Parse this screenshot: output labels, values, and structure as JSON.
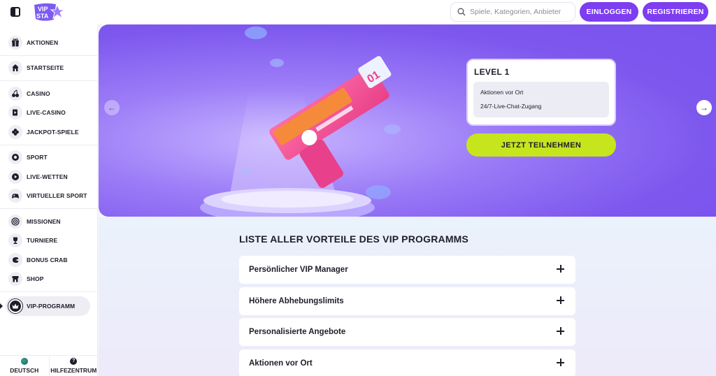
{
  "header": {
    "logo_text": "VIP STAR",
    "search_placeholder": "Spiele, Kategorien, Anbieter",
    "login_label": "EINLOGGEN",
    "register_label": "REGISTRIEREN",
    "accent_color": "#7d3df0"
  },
  "sidebar": {
    "groups": [
      [
        {
          "label": "AKTIONEN",
          "icon": "gift-icon"
        }
      ],
      [
        {
          "label": "STARTSEITE",
          "icon": "home-icon"
        }
      ],
      [
        {
          "label": "CASINO",
          "icon": "cherries-icon"
        },
        {
          "label": "LIVE-CASINO",
          "icon": "live-cards-icon"
        },
        {
          "label": "JACKPOT-SPIELE",
          "icon": "clover-icon"
        }
      ],
      [
        {
          "label": "SPORT",
          "icon": "soccer-ball-icon"
        },
        {
          "label": "LIVE-WETTEN",
          "icon": "play-icon"
        },
        {
          "label": "VIRTUELLER SPORT",
          "icon": "gamepad-icon"
        }
      ],
      [
        {
          "label": "MISSIONEN",
          "icon": "target-icon"
        },
        {
          "label": "TURNIERE",
          "icon": "trophy-icon"
        },
        {
          "label": "BONUS CRAB",
          "icon": "crab-icon"
        },
        {
          "label": "SHOP",
          "icon": "shop-icon"
        }
      ],
      [
        {
          "label": "VIP-PROGRAMM",
          "icon": "crown-icon",
          "active": true
        }
      ]
    ],
    "footer": {
      "language_label": "DEUTSCH",
      "help_label": "HILFEZENTRUM"
    }
  },
  "hero": {
    "level_title": "LEVEL 1",
    "perks": [
      "Aktionen vor Ort",
      "24/7-Live-Chat-Zugang"
    ],
    "cta_label": "JETZT TEILNEHMEN",
    "cta_color": "#c6e51c",
    "gun_number": "01"
  },
  "benefits": {
    "title": "LISTE ALLER VORTEILE DES VIP PROGRAMMS",
    "items": [
      "Persönlicher VIP Manager",
      "Höhere Abhebungslimits",
      "Personalisierte Angebote",
      "Aktionen vor Ort"
    ]
  }
}
